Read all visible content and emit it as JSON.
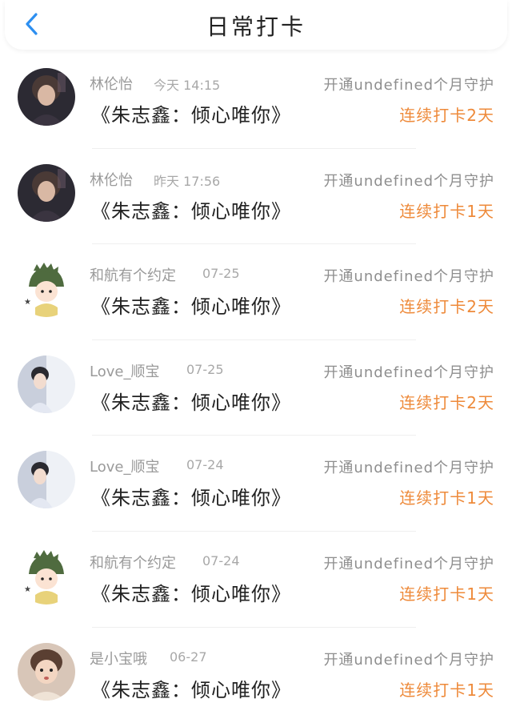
{
  "header": {
    "title": "日常打卡",
    "back_icon": "chevron-left-icon",
    "accent": "#2d8ff0"
  },
  "colors": {
    "streak": "#ee8a3a",
    "muted": "#9a9a9a"
  },
  "items": [
    {
      "name": "林伦怡",
      "time": "今天 14:15",
      "message": "《朱志鑫：倾心唯你》",
      "guard": "开通undefined个月守护",
      "streak": "连续打卡2天",
      "avatar": "photo-avatar"
    },
    {
      "name": "林伦怡",
      "time": "昨天 17:56",
      "message": "《朱志鑫：倾心唯你》",
      "guard": "开通undefined个月守护",
      "streak": "连续打卡1天",
      "avatar": "photo-avatar"
    },
    {
      "name": "和航有个约定",
      "time": "07-25",
      "message": "《朱志鑫：倾心唯你》",
      "guard": "开通undefined个月守护",
      "streak": "连续打卡2天",
      "avatar": "dinosaur-cartoon-avatar"
    },
    {
      "name": "Love_顺宝",
      "time": "07-25",
      "message": "《朱志鑫：倾心唯你》",
      "guard": "开通undefined个月守护",
      "streak": "连续打卡2天",
      "avatar": "photo-avatar"
    },
    {
      "name": "Love_顺宝",
      "time": "07-24",
      "message": "《朱志鑫：倾心唯你》",
      "guard": "开通undefined个月守护",
      "streak": "连续打卡1天",
      "avatar": "photo-avatar"
    },
    {
      "name": "和航有个约定",
      "time": "07-24",
      "message": "《朱志鑫：倾心唯你》",
      "guard": "开通undefined个月守护",
      "streak": "连续打卡1天",
      "avatar": "dinosaur-cartoon-avatar"
    },
    {
      "name": "是小宝哦",
      "time": "06-27",
      "message": "《朱志鑫：倾心唯你》",
      "guard": "开通undefined个月守护",
      "streak": "连续打卡1天",
      "avatar": "photo-avatar"
    }
  ]
}
